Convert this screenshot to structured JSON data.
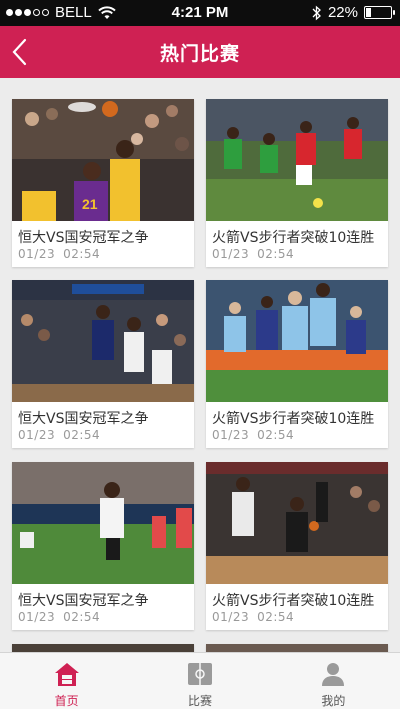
{
  "status_bar": {
    "carrier": "BELL",
    "time": "4:21 PM",
    "battery": "22%",
    "battery_level": 0.22
  },
  "header": {
    "title": "热门比赛",
    "back_icon": "chevron-left-icon",
    "color": "#cf2153"
  },
  "cards": [
    {
      "title": "恒大VS国安冠军之争",
      "date": "01/23",
      "time": "02:54",
      "scene": "basketball-lakers"
    },
    {
      "title": "火箭VS步行者突破10连胜",
      "date": "01/23",
      "time": "02:54",
      "scene": "soccer-red-green"
    },
    {
      "title": "恒大VS国安冠军之争",
      "date": "01/23",
      "time": "02:54",
      "scene": "basketball-knicks"
    },
    {
      "title": "火箭VS步行者突破10连胜",
      "date": "01/23",
      "time": "02:54",
      "scene": "soccer-celebration"
    },
    {
      "title": "恒大VS国安冠军之争",
      "date": "01/23",
      "time": "02:54",
      "scene": "soccer-white"
    },
    {
      "title": "火箭VS步行者突破10连胜",
      "date": "01/23",
      "time": "02:54",
      "scene": "basketball-spurs"
    }
  ],
  "tabbar": {
    "items": [
      {
        "label": "首页",
        "icon": "home-icon",
        "active": true
      },
      {
        "label": "比赛",
        "icon": "field-icon",
        "active": false
      },
      {
        "label": "我的",
        "icon": "person-icon",
        "active": false
      }
    ],
    "active_color": "#cf2153"
  }
}
